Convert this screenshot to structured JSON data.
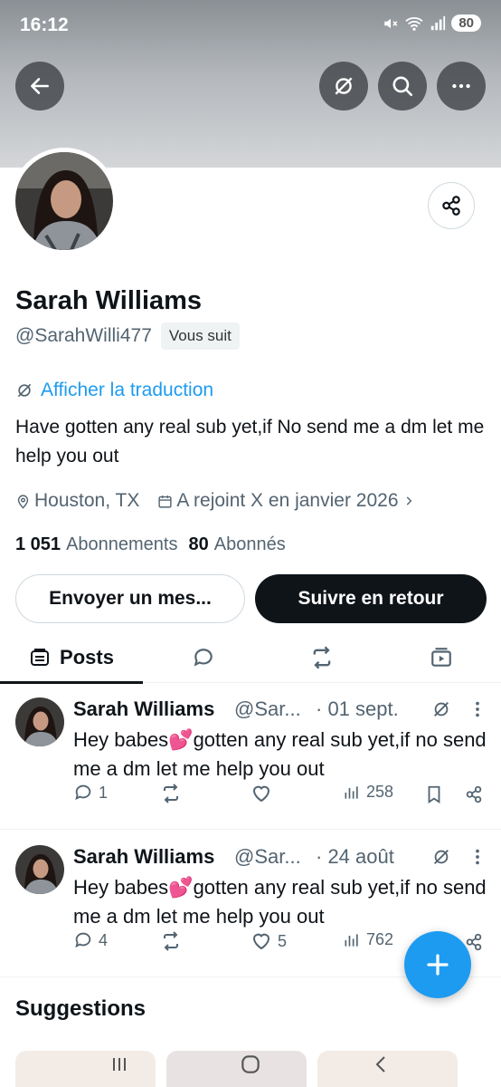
{
  "status_bar": {
    "time": "16:12",
    "wifi_label": "5",
    "battery": "80"
  },
  "colors": {
    "accent": "#1d9bf0",
    "text": "#0f1419",
    "muted": "#536471",
    "button_dark": "#0f1419"
  },
  "profile": {
    "name": "Sarah Williams",
    "handle": "@SarahWilli477",
    "follows_you": "Vous suit",
    "translate_link": "Afficher la traduction",
    "bio": "Have gotten any real sub yet,if No send me a dm let me help you out",
    "location": "Houston, TX",
    "joined": "A rejoint X en janvier 2026",
    "following_count": "1 051",
    "following_label": "Abonnements",
    "followers_count": "80",
    "followers_label": "Abonnés"
  },
  "buttons": {
    "message": "Envoyer un mes...",
    "follow_back": "Suivre en retour"
  },
  "tabs": {
    "posts": "Posts"
  },
  "posts": [
    {
      "name": "Sarah Williams",
      "handle": "@Sar...",
      "date": "· 01 sept.",
      "text": "Hey babes💕gotten any real sub yet,if no send me a dm let me help you out",
      "replies": "1",
      "reposts": "",
      "likes": "",
      "views": "258"
    },
    {
      "name": "Sarah Williams",
      "handle": "@Sar...",
      "date": "· 24 août",
      "text": "Hey babes💕gotten any real sub yet,if no send me a dm let me help you out",
      "replies": "4",
      "reposts": "",
      "likes": "5",
      "views": "762"
    }
  ],
  "suggestions": {
    "title": "Suggestions"
  },
  "icons": [
    "back-arrow-icon",
    "no-translate-icon",
    "search-icon",
    "more-icon",
    "share-icon",
    "location-icon",
    "calendar-icon",
    "chevron-right-icon",
    "posts-tab-icon",
    "replies-tab-icon",
    "reposts-tab-icon",
    "media-tab-icon",
    "reply-icon",
    "repost-icon",
    "like-icon",
    "views-icon",
    "bookmark-icon",
    "plus-icon"
  ]
}
